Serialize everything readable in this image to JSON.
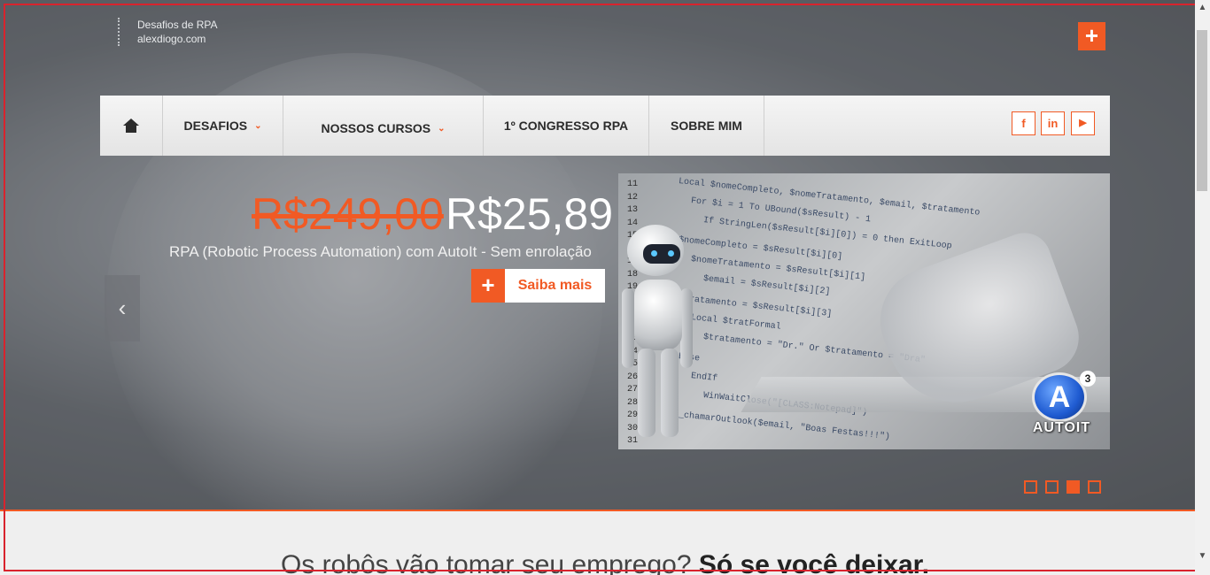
{
  "topbar": {
    "line1": "Desafios de RPA",
    "line2": "alexdiogo.com"
  },
  "header": {
    "plus_icon": "+"
  },
  "nav": {
    "home_icon": "home-icon",
    "items": [
      {
        "label": "DESAFIOS",
        "caret": "⌄"
      },
      {
        "label": "NOSSOS CURSOS",
        "caret": "⌄"
      },
      {
        "label": "1º CONGRESSO RPA"
      },
      {
        "label": "SOBRE MIM"
      }
    ],
    "social": {
      "facebook": "f",
      "linkedin": "in",
      "youtube": "▶"
    }
  },
  "slide": {
    "price_old": "R$249,00",
    "price_new": "R$25,89",
    "subtitle": "RPA (Robotic Process Automation) com AutoIt - Sem enrolação",
    "cta_plus": "+",
    "cta_label": "Saiba mais",
    "prev_arrow": "‹",
    "next_arrow": "›",
    "image_logo_word": "AUTOIT",
    "image_logo_letter": "A",
    "image_logo_number": "3",
    "line_numbers": [
      "11",
      "12",
      "13",
      "14",
      "15",
      "16",
      "17",
      "18",
      "19",
      "20",
      "21",
      "22",
      "23",
      "24",
      "25",
      "26",
      "27",
      "28",
      "29",
      "30",
      "31"
    ],
    "code_lines": [
      "Local $nomeCompleto, $nomeTratamento, $email, $tratamento",
      "For $i = 1 To UBound($sResult) - 1",
      "If StringLen($sResult[$i][0]) = 0 then ExitLoop",
      "$nomeCompleto = $sResult[$i][0]",
      "$nomeTratamento = $sResult[$i][1]",
      "$email = $sResult[$i][2]",
      "$tratamento = $sResult[$i][3]",
      "Local $tratFormal",
      "$tratamento = \"Dr.\" Or $tratamento = \"Dra\"",
      "Else",
      "EndIf",
      "WinWaitClose(\"[CLASS:Notepad]\")",
      "_chamarOutlook($email, \"Boas Festas!!!\")"
    ]
  },
  "carousel": {
    "dots": [
      false,
      false,
      true,
      false
    ]
  },
  "tagline": {
    "light": "Os robôs vão tomar seu emprego? ",
    "bold": "Só se você deixar."
  },
  "scrollbar": {
    "up": "▲",
    "down": "▼"
  },
  "colors": {
    "accent": "#f15a24",
    "frame": "#d9232d"
  }
}
